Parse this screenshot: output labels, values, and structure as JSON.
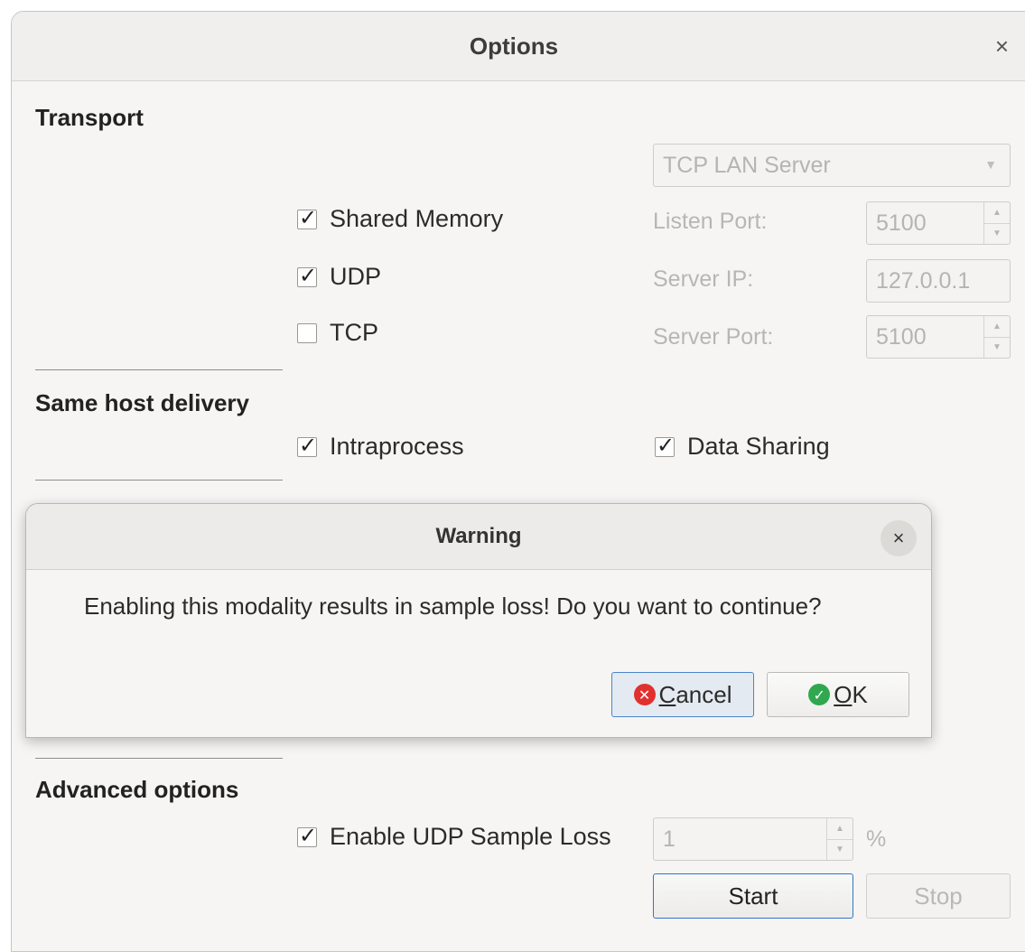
{
  "window": {
    "title": "Options",
    "close_glyph": "×"
  },
  "transport": {
    "heading": "Transport",
    "mode_select": {
      "value": "TCP LAN Server"
    },
    "checkboxes": [
      {
        "label": "Shared Memory",
        "checked": true
      },
      {
        "label": "UDP",
        "checked": true
      },
      {
        "label": "TCP",
        "checked": false
      }
    ],
    "listen_port": {
      "label": "Listen Port:",
      "value": "5100"
    },
    "server_ip": {
      "label": "Server IP:",
      "value": "127.0.0.1"
    },
    "server_port": {
      "label": "Server Port:",
      "value": "5100"
    }
  },
  "same_host": {
    "heading": "Same host delivery",
    "intraprocess": {
      "label": "Intraprocess",
      "checked": true
    },
    "data_sharing": {
      "label": "Data Sharing",
      "checked": true
    }
  },
  "advanced": {
    "heading": "Advanced options",
    "udp_loss": {
      "label": "Enable UDP Sample Loss",
      "checked": true,
      "value": "1",
      "unit": "%"
    },
    "start_label": "Start",
    "stop_label": "Stop"
  },
  "warning": {
    "title": "Warning",
    "close_glyph": "×",
    "message": "Enabling this modality results in sample loss! Do you want to continue?",
    "cancel": {
      "mnemonic": "C",
      "rest": "ancel",
      "icon": "cancel-icon",
      "color": "#e0312f"
    },
    "ok": {
      "mnemonic": "O",
      "rest": "K",
      "icon": "ok-icon",
      "color": "#2fa84f"
    }
  }
}
